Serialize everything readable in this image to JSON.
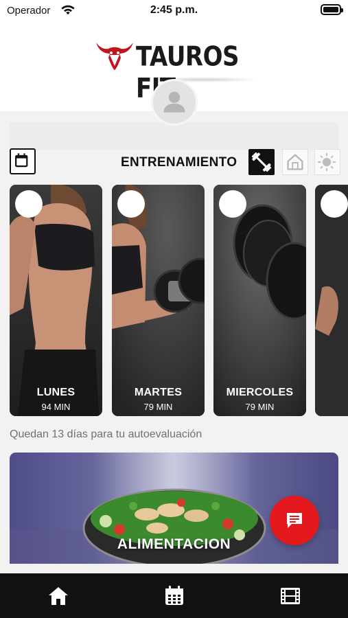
{
  "status_bar": {
    "carrier": "Operador",
    "time": "2:45 p.m.",
    "icons": [
      "wifi-icon",
      "battery-icon"
    ]
  },
  "header": {
    "brand": "TAUROS FIT",
    "logo_icon": "bull-icon",
    "brand_color": "#c0151c",
    "avatar_icon": "user-icon"
  },
  "section": {
    "title": "ENTRENAMIENTO",
    "calendar_icon": "calendar-icon",
    "modes": [
      {
        "name": "gym",
        "icon": "dumbbell-icon",
        "active": true
      },
      {
        "name": "home",
        "icon": "home-icon",
        "active": false
      },
      {
        "name": "outdoor",
        "icon": "sun-icon",
        "active": false
      }
    ]
  },
  "days": [
    {
      "day": "LUNES",
      "duration": "94 MIN"
    },
    {
      "day": "MARTES",
      "duration": "79 MIN"
    },
    {
      "day": "MIERCOLES",
      "duration": "79 MIN"
    },
    {
      "day": "",
      "duration": ""
    }
  ],
  "reminder": "Quedan 13 días para tu autoevaluación",
  "food_banner": {
    "label": "ALIMENTACION"
  },
  "chat_button": {
    "icon": "chat-icon",
    "color": "#e3191e"
  },
  "bottom_nav": [
    {
      "name": "home",
      "icon": "home-icon"
    },
    {
      "name": "calendar",
      "icon": "calendar-icon"
    },
    {
      "name": "videos",
      "icon": "film-icon"
    }
  ]
}
